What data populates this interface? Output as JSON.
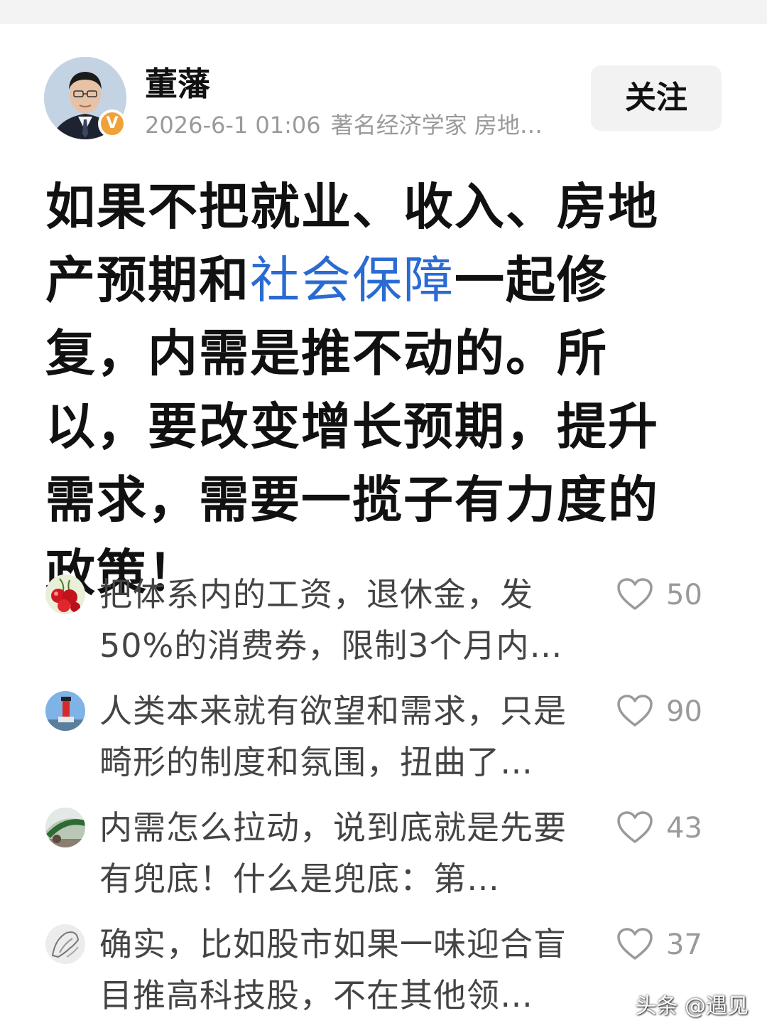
{
  "author": {
    "name": "董藩",
    "timestamp": "2026-6-1 01:06",
    "description": "著名经济学家 房地…",
    "verified_badge": "V",
    "follow_label": "关注"
  },
  "post": {
    "text_before": "如果不把就业、收入、房地产预期和",
    "topic_link": "社会保障",
    "text_after": "一起修复，内需是推不动的。所以，要改变增长预期，提升需求，需要一揽子有力度的政策！"
  },
  "comments": [
    {
      "text": "把体系内的工资，退休金，发50%的消费券，限制3个月内…",
      "likes": "50"
    },
    {
      "text": "人类本来就有欲望和需求，只是畸形的制度和氛围，扭曲了…",
      "likes": "90"
    },
    {
      "text": "内需怎么拉动，说到底就是先要有兜底！什么是兜底：第…",
      "likes": "43"
    },
    {
      "text": "确实，比如股市如果一味迎合盲目推高科技股，不在其他领…",
      "likes": "37"
    }
  ],
  "watermark": "头条 @遇见",
  "colors": {
    "link": "#2a6bd3",
    "badge": "#f0a23a",
    "muted": "#9a9a9a"
  },
  "icons": {
    "like": "heart-outline-icon",
    "verified": "verified-v-icon"
  }
}
